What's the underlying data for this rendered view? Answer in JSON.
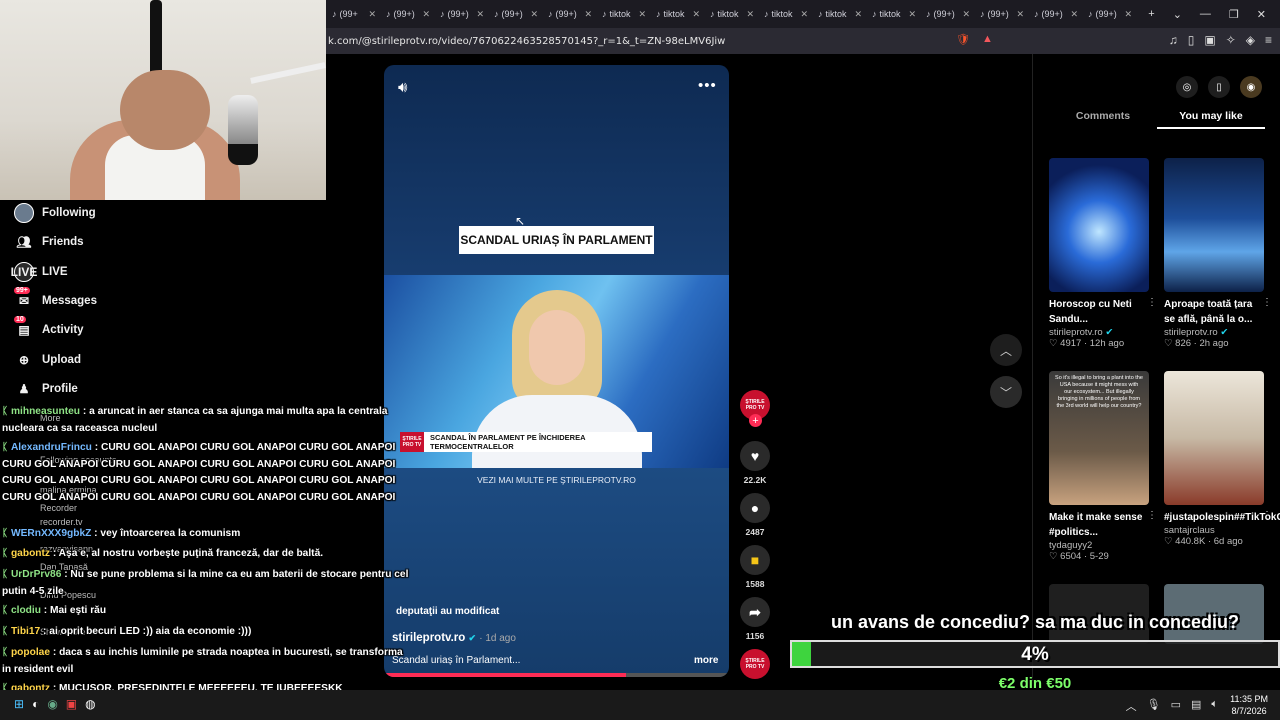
{
  "browser": {
    "tabs": [
      {
        "label": "(99+"
      },
      {
        "label": "(99+)"
      },
      {
        "label": "(99+)"
      },
      {
        "label": "(99+)"
      },
      {
        "label": "(99+)"
      },
      {
        "label": "tiktok"
      },
      {
        "label": "tiktok"
      },
      {
        "label": "tiktok"
      },
      {
        "label": "tiktok"
      },
      {
        "label": "tiktok"
      },
      {
        "label": "tiktok"
      },
      {
        "label": "(99+)"
      },
      {
        "label": "(99+)"
      },
      {
        "label": "(99+)"
      },
      {
        "label": "(99+)"
      }
    ],
    "url": "k.com/@stirileprotv.ro/video/7670622463528570145?_r=1&_t=ZN-98eLMV6Jiw"
  },
  "sidebar": {
    "items": [
      {
        "label": "Following",
        "icon": "avatar-icon"
      },
      {
        "label": "Friends",
        "icon": "friends-icon"
      },
      {
        "label": "LIVE",
        "icon": "live-icon"
      },
      {
        "label": "Messages",
        "icon": "messages-icon",
        "badge": "99+"
      },
      {
        "label": "Activity",
        "icon": "activity-icon",
        "badge": "10"
      },
      {
        "label": "Upload",
        "icon": "upload-icon"
      },
      {
        "label": "Profile",
        "icon": "profile-icon"
      }
    ],
    "ghost": [
      "More",
      "Following accounts",
      "malina.ermina",
      "Recorder",
      "recorder.tv",
      "razvanvisann",
      "Dan Tanasă",
      "Dinu Popescu",
      "Show more"
    ]
  },
  "chat": [
    {
      "user": "mihneasunteu",
      "msg": " : a aruncat in aer stanca ca sa ajunga mai multa apa la centrala nucleara ca sa raceasca nucleul",
      "color": "green"
    },
    {
      "user": "AlexandruFrincu",
      "msg": " : CURU GOL ANAPOI CURU GOL ANAPOI CURU GOL ANAPOI CURU GOL ANAPOI CURU GOL ANAPOI CURU GOL ANAPOI CURU GOL ANAPOI CURU GOL ANAPOI CURU GOL ANAPOI CURU GOL ANAPOI CURU GOL ANAPOI CURU GOL ANAPOI CURU GOL ANAPOI CURU GOL ANAPOI CURU GOL ANAPOI",
      "color": "blue"
    },
    {
      "user": "WERnXXX9gbkZ",
      "msg": " : vey întoarcerea la comunism",
      "color": "blue"
    },
    {
      "user": "gabontz",
      "msg": " : Aşa e, al nostru vorbeşte puţină franceză, dar de baltă.",
      "color": "yel"
    },
    {
      "user": "UrDrPrv86",
      "msg": " : Nu se pune problema si la mine ca eu am baterii de stocare pentru cel putin 4-5 zile",
      "color": "green"
    },
    {
      "user": "clodiu",
      "msg": " : Mai eşti rău",
      "color": "green"
    },
    {
      "user": "Tibi17",
      "msg": " : ai oprit becuri LED :)) aia da economie :)))",
      "color": "yel"
    },
    {
      "user": "popolae",
      "msg": " : daca s au inchis luminile pe strada noaptea in bucuresti, se transforma in resident evil",
      "color": "yel"
    },
    {
      "user": "gabontz",
      "msg": " : MUCUŞOR, PREŞEDINTELE MEEEEEEU, TE IUBEEEESKK",
      "color": "yel"
    },
    {
      "user": "Biggie96",
      "msg": " : Nicu Şordan",
      "color": "green"
    }
  ],
  "video": {
    "headline": "SCANDAL URIAȘ ÎN PARLAMENT",
    "lower_third": "SCANDAL ÎN PARLAMENT PE ÎNCHIDEREA TERMOCENTRALELOR",
    "logo_text": "ŞTIRILE PRO TV",
    "vezi": "VEZI MAI MULTE PE ŞTIRILEPROTV.RO",
    "caption": "deputaţii au modificat",
    "author": "stirileprotv.ro",
    "time": "· 1d ago",
    "desc": "Scandal uriaș în Parlament...",
    "more": "more",
    "progress": 0.7
  },
  "actions": {
    "likes": "22.2K",
    "comments": "2487",
    "saves": "1588",
    "shares": "1156"
  },
  "right_panel": {
    "tabs": [
      "Comments",
      "You may like"
    ],
    "active_tab": "You may like",
    "cards": [
      {
        "title": "Horoscop cu Neti Sandu...",
        "author": "stirileprotv.ro",
        "likes": "4917",
        "age": "· 12h ago"
      },
      {
        "title": "Aproape toată țara se află, până la o...",
        "author": "stirileprotv.ro",
        "likes": "826",
        "age": "· 2h ago"
      },
      {
        "title": "Make it make sense #politics...",
        "author": "tydaguyy2",
        "likes": "6504",
        "age": "· 5-29"
      },
      {
        "title": "#justapolespin##TikTokCampaign...",
        "author": "santajrclaus",
        "likes": "440.8K",
        "age": "· 6d ago"
      }
    ],
    "card3_text": "So it's illegal to bring a plant into the USA because it might mess with our ecosystem... But illegally bringing in millions of people from the 3rd world will help our country?"
  },
  "donation": {
    "title": "un avans de concediu? sa ma duc in concediu?",
    "percent": "4%",
    "amount": "€2 din €50",
    "fraction": 0.04
  },
  "taskbar": {
    "time": "11:35 PM",
    "date": "8/7/2026"
  }
}
